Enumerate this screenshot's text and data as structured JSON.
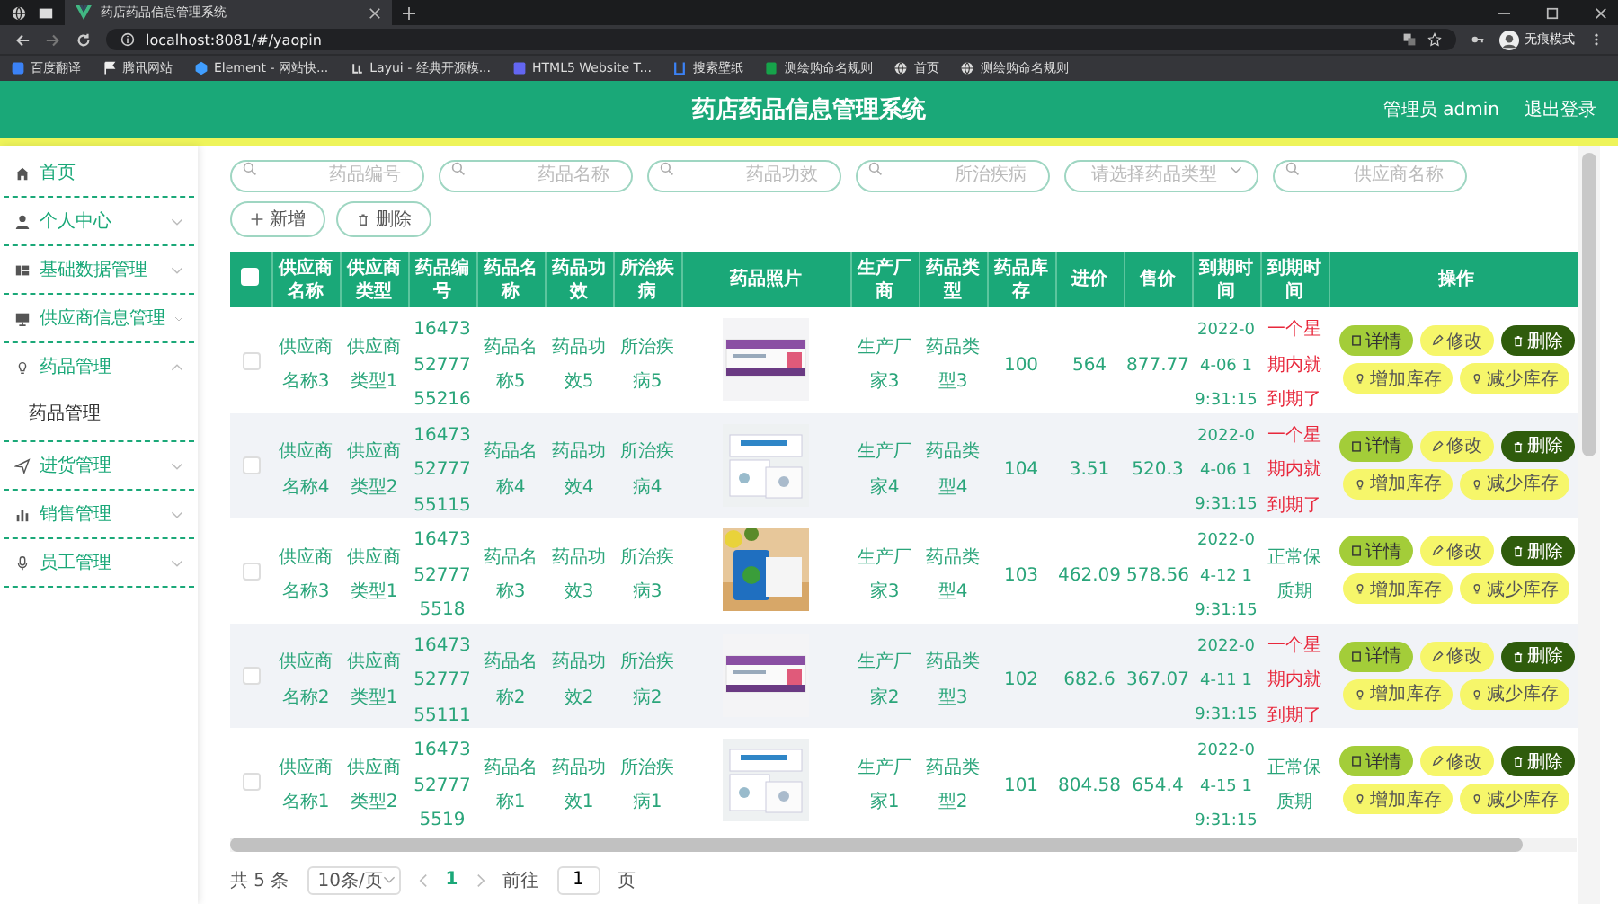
{
  "browser": {
    "tab_title": "药店药品信息管理系统",
    "url": "localhost:8081/#/yaopin",
    "profile": "无痕模式",
    "bookmarks": [
      {
        "label": "百度翻译",
        "kind": "blue"
      },
      {
        "label": "腾讯网站",
        "kind": "flag"
      },
      {
        "label": "Element - 网站快...",
        "kind": "element"
      },
      {
        "label": "Layui - 经典开源模...",
        "kind": "layui"
      },
      {
        "label": "HTML5 Website T...",
        "kind": "html"
      },
      {
        "label": "搜索壁纸",
        "kind": "bracket"
      },
      {
        "label": "测绘购命名规则",
        "kind": "green"
      },
      {
        "label": "首页",
        "kind": "globe"
      },
      {
        "label": "测绘购命名规则",
        "kind": "globe"
      }
    ]
  },
  "header": {
    "title": "药店药品信息管理系统",
    "user": "管理员 admin",
    "logout": "退出登录"
  },
  "sidebar": {
    "items": [
      {
        "label": "首页",
        "kind": "home"
      },
      {
        "label": "个人中心",
        "kind": "user",
        "expanded": false
      },
      {
        "label": "基础数据管理",
        "kind": "grid",
        "expanded": false
      },
      {
        "label": "供应商信息管理",
        "kind": "monitor",
        "expanded": false
      },
      {
        "label": "药品管理",
        "kind": "bulb",
        "expanded": true,
        "children": [
          {
            "label": "药品管理"
          }
        ]
      },
      {
        "label": "进货管理",
        "kind": "send",
        "expanded": false
      },
      {
        "label": "销售管理",
        "kind": "chart",
        "expanded": false
      },
      {
        "label": "员工管理",
        "kind": "mic",
        "expanded": false
      }
    ]
  },
  "filters": [
    {
      "placeholder": "药品编号",
      "kind": "search"
    },
    {
      "placeholder": "药品名称",
      "kind": "search"
    },
    {
      "placeholder": "药品功效",
      "kind": "search"
    },
    {
      "placeholder": "所治疾病",
      "kind": "search"
    },
    {
      "placeholder": "请选择药品类型",
      "kind": "select"
    },
    {
      "placeholder": "供应商名称",
      "kind": "search"
    }
  ],
  "actions": [
    {
      "label": "新增",
      "kind": "add"
    },
    {
      "label": "删除",
      "kind": "delete"
    }
  ],
  "table": {
    "select_all": {
      "checked": false
    },
    "columns": [
      {
        "label": "供应商名称",
        "kind": "text"
      },
      {
        "label": "供应商类型",
        "kind": "text"
      },
      {
        "label": "药品编号",
        "kind": "text"
      },
      {
        "label": "药品名称",
        "kind": "text"
      },
      {
        "label": "药品功效",
        "kind": "text"
      },
      {
        "label": "所治疾病",
        "kind": "text"
      },
      {
        "label": "药品照片"
      },
      {
        "label": "生产厂商",
        "kind": "text"
      },
      {
        "label": "药品类型",
        "kind": "text"
      },
      {
        "label": "药品库存",
        "kind": "text"
      },
      {
        "label": "进价",
        "kind": "text"
      },
      {
        "label": "售价",
        "kind": "text"
      },
      {
        "label": "到期时间",
        "kind": "time"
      },
      {
        "label": "到期时间",
        "kind": "status"
      },
      {
        "label": "操作",
        "kind": "actions"
      }
    ],
    "rows": [
      {
        "checked": false,
        "cells": [
          "供应商名称3",
          "供应商类型1",
          "164735277755216",
          "药品名称5",
          "药品功效5",
          "所治疾病5",
          {
            "kind": "picture"
          },
          "生产厂家3",
          "药品类型3",
          "100",
          "564",
          "877.77",
          "2022-04-06 19:31:15",
          {
            "text": "一个星期内就到期了",
            "kind": "expiring"
          }
        ],
        "actions": [
          {
            "label": "详情",
            "kind": "detail"
          },
          {
            "label": "修改",
            "kind": "edit"
          },
          {
            "label": "删除",
            "kind": "delete"
          },
          {
            "label": "增加库存",
            "kind": "stock"
          },
          {
            "label": "减少库存",
            "kind": "stock"
          }
        ]
      },
      {
        "checked": false,
        "cells": [
          "供应商名称4",
          "供应商类型2",
          "164735277755115",
          "药品名称4",
          "药品功效4",
          "所治疾病4",
          {
            "kind": "picture"
          },
          "生产厂家4",
          "药品类型4",
          "104",
          "3.51",
          "520.3",
          "2022-04-06 19:31:15",
          {
            "text": "一个星期内就到期了",
            "kind": "expiring"
          }
        ],
        "actions": [
          {
            "label": "详情",
            "kind": "detail"
          },
          {
            "label": "修改",
            "kind": "edit"
          },
          {
            "label": "删除",
            "kind": "delete"
          },
          {
            "label": "增加库存",
            "kind": "stock"
          },
          {
            "label": "减少库存",
            "kind": "stock"
          }
        ]
      },
      {
        "checked": false,
        "cells": [
          "供应商名称3",
          "供应商类型1",
          "16473527775518",
          "药品名称3",
          "药品功效3",
          "所治疾病3",
          {
            "kind": "picture"
          },
          "生产厂家3",
          "药品类型4",
          "103",
          "462.09",
          "578.56",
          "2022-04-12 19:31:15",
          {
            "text": "正常保质期",
            "kind": "normal"
          }
        ],
        "actions": [
          {
            "label": "详情",
            "kind": "detail"
          },
          {
            "label": "修改",
            "kind": "edit"
          },
          {
            "label": "删除",
            "kind": "delete"
          },
          {
            "label": "增加库存",
            "kind": "stock"
          },
          {
            "label": "减少库存",
            "kind": "stock"
          }
        ]
      },
      {
        "checked": false,
        "cells": [
          "供应商名称2",
          "供应商类型1",
          "164735277755111",
          "药品名称2",
          "药品功效2",
          "所治疾病2",
          {
            "kind": "picture"
          },
          "生产厂家2",
          "药品类型3",
          "102",
          "682.6",
          "367.07",
          "2022-04-11 19:31:15",
          {
            "text": "一个星期内就到期了",
            "kind": "expiring"
          }
        ],
        "actions": [
          {
            "label": "详情",
            "kind": "detail"
          },
          {
            "label": "修改",
            "kind": "edit"
          },
          {
            "label": "删除",
            "kind": "delete"
          },
          {
            "label": "增加库存",
            "kind": "stock"
          },
          {
            "label": "减少库存",
            "kind": "stock"
          }
        ]
      },
      {
        "checked": false,
        "cells": [
          "供应商名称1",
          "供应商类型2",
          "16473527775519",
          "药品名称1",
          "药品功效1",
          "所治疾病1",
          {
            "kind": "picture"
          },
          "生产厂家1",
          "药品类型2",
          "101",
          "804.58",
          "654.4",
          "2022-04-15 19:31:15",
          {
            "text": "正常保质期",
            "kind": "normal"
          }
        ],
        "actions": [
          {
            "label": "详情",
            "kind": "detail"
          },
          {
            "label": "修改",
            "kind": "edit"
          },
          {
            "label": "删除",
            "kind": "delete"
          },
          {
            "label": "增加库存",
            "kind": "stock"
          },
          {
            "label": "减少库存",
            "kind": "stock"
          }
        ]
      }
    ]
  },
  "pagination": {
    "total": "共 5 条",
    "page_size": "10条/页",
    "pages": [
      {
        "label": "1",
        "selected": true
      }
    ],
    "goto_label": "前往",
    "goto_value": "1",
    "unit": "页"
  }
}
